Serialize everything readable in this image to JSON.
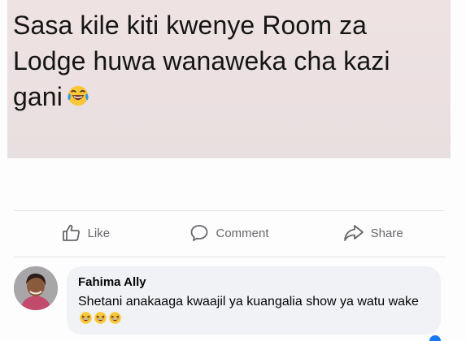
{
  "post": {
    "text": "Sasa kile kiti kwenye Room za Lodge huwa wanaweka cha kazi gani",
    "emoji": "face-with-tears-of-joy-icon"
  },
  "actions": {
    "like_label": "Like",
    "comment_label": "Comment",
    "share_label": "Share"
  },
  "comment": {
    "author": "Fahima Ally",
    "text": "Shetani anakaaga kwaajil ya kuangalia show ya watu wake",
    "emoji_count": 3
  },
  "colors": {
    "action_text": "#65676b",
    "bubble": "#f0f2f5",
    "post_background": "#eadfe0"
  }
}
